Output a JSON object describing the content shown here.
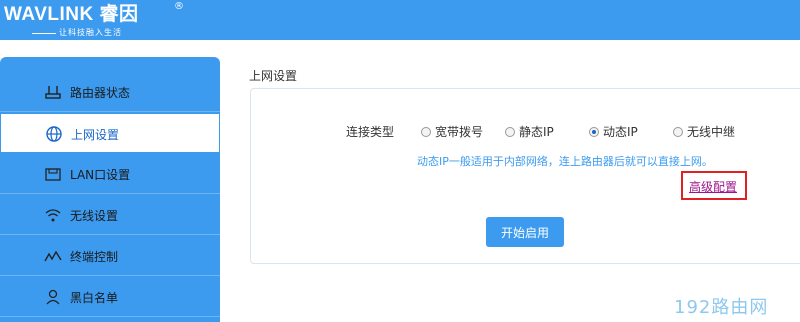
{
  "brand": {
    "logo_text": "WAVLINK 睿因",
    "registered": "®",
    "slogan": "让科技融入生活"
  },
  "sidebar": {
    "items": [
      {
        "label": "路由器状态",
        "icon": "router-icon",
        "active": false
      },
      {
        "label": "上网设置",
        "icon": "globe-icon",
        "active": true
      },
      {
        "label": "LAN口设置",
        "icon": "lan-port-icon",
        "active": false
      },
      {
        "label": "无线设置",
        "icon": "wifi-icon",
        "active": false
      },
      {
        "label": "终端控制",
        "icon": "terminal-control-icon",
        "active": false
      },
      {
        "label": "黑白名单",
        "icon": "user-list-icon",
        "active": false
      }
    ]
  },
  "main": {
    "section_title": "上网设置",
    "connection_type_label": "连接类型",
    "options": [
      {
        "label": "宽带拨号",
        "selected": false
      },
      {
        "label": "静态IP",
        "selected": false
      },
      {
        "label": "动态IP",
        "selected": true
      },
      {
        "label": "无线中继",
        "selected": false
      }
    ],
    "hint": "动态IP一般适用于内部网络，连上路由器后就可以直接上网。",
    "advanced_link": "高级配置",
    "start_button": "开始启用"
  },
  "watermark": "192路由网",
  "colors": {
    "accent": "#3c9bef",
    "highlight_border": "#dd2222",
    "link": "#a0148a"
  }
}
